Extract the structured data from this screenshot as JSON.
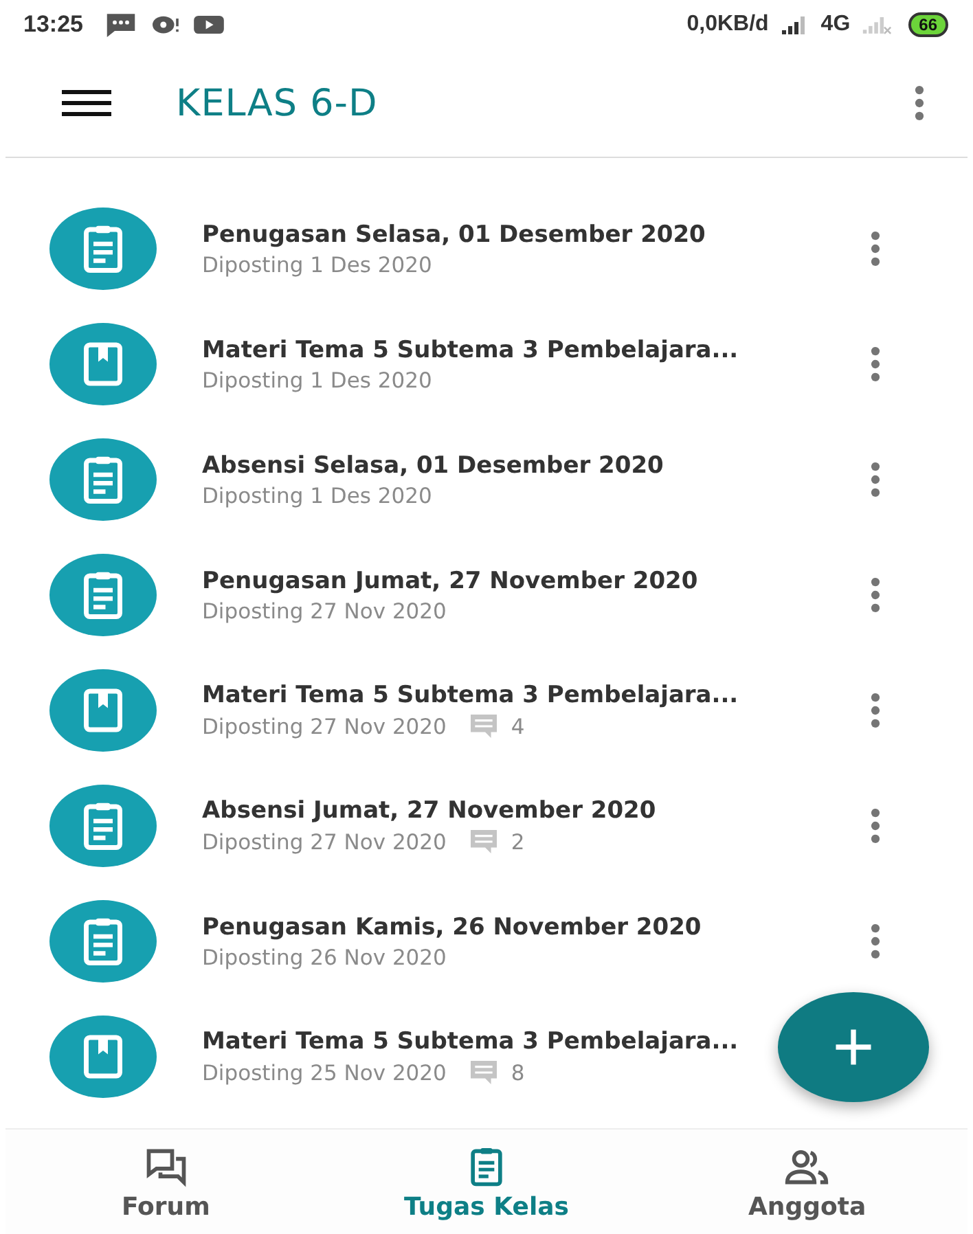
{
  "status_bar": {
    "time": "13:25",
    "network_speed": "0,0KB/d",
    "network_type": "4G",
    "battery": "66"
  },
  "app_bar": {
    "title": "KELAS 6-D"
  },
  "items": [
    {
      "kind": "assignment",
      "title": "Penugasan Selasa, 01 Desember 2020",
      "posted": "Diposting 1 Des 2020",
      "menu": true
    },
    {
      "kind": "material",
      "title": "Materi Tema 5 Subtema 3 Pembelajara...",
      "posted": "Diposting 1 Des 2020",
      "menu": true
    },
    {
      "kind": "assignment",
      "title": "Absensi Selasa, 01 Desember 2020",
      "posted": "Diposting 1 Des 2020",
      "menu": true
    },
    {
      "kind": "assignment",
      "title": "Penugasan Jumat, 27 November 2020",
      "posted": "Diposting 27 Nov 2020",
      "menu": true
    },
    {
      "kind": "material",
      "title": "Materi Tema 5 Subtema 3 Pembelajara...",
      "posted": "Diposting 27 Nov 2020",
      "comments": "4",
      "menu": true
    },
    {
      "kind": "assignment",
      "title": "Absensi Jumat, 27 November 2020",
      "posted": "Diposting 27 Nov 2020",
      "comments": "2",
      "menu": true
    },
    {
      "kind": "assignment",
      "title": "Penugasan Kamis, 26 November 2020",
      "posted": "Diposting 26 Nov 2020",
      "menu": true
    },
    {
      "kind": "material",
      "title": "Materi Tema 5 Subtema 3 Pembelajara...",
      "posted": "Diposting 25 Nov 2020",
      "comments": "8",
      "menu": false
    }
  ],
  "bottom_nav": [
    {
      "kind": "forum",
      "label": "Forum",
      "selected": false
    },
    {
      "kind": "assignment",
      "label": "Tugas Kelas",
      "selected": true
    },
    {
      "kind": "members",
      "label": "Anggota",
      "selected": false
    }
  ]
}
